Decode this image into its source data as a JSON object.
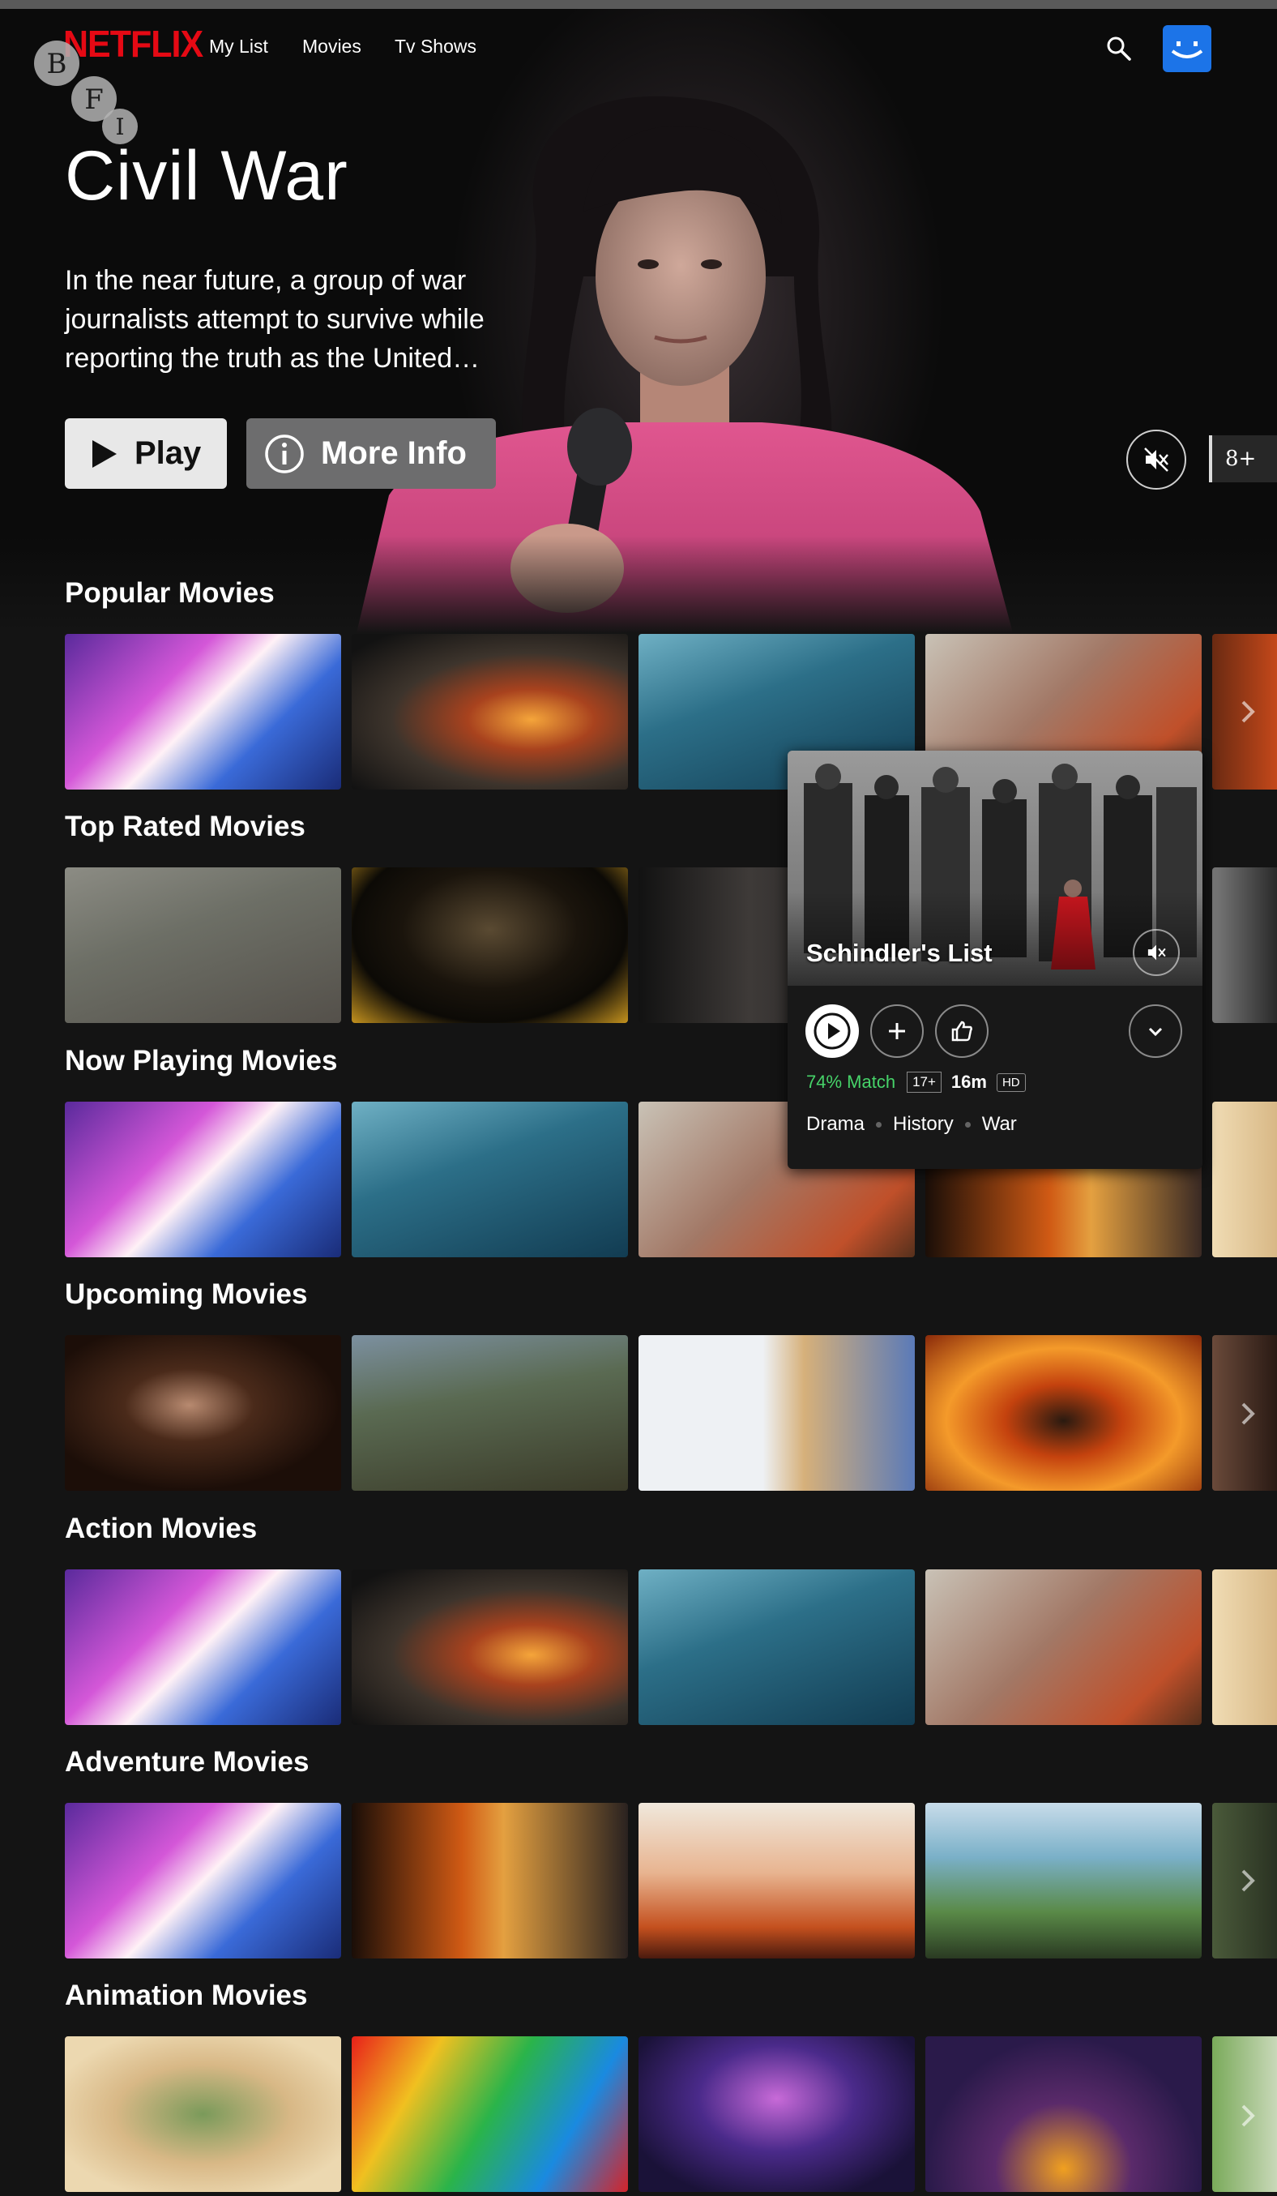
{
  "navbar": {
    "logo": "NETFLIX",
    "links": [
      "My List",
      "Movies",
      "Tv Shows"
    ],
    "icons": {
      "search": "search-icon",
      "profile": "profile-avatar"
    },
    "accent": "#e50914"
  },
  "watermark": {
    "letters": [
      "B",
      "F",
      "I"
    ]
  },
  "hero": {
    "title": "Civil War",
    "description": "In the near future, a group of war journalists attempt to survive while reporting the truth as the United…",
    "play_label": "Play",
    "info_label": "More Info",
    "maturity_rating": "8+"
  },
  "rows": [
    {
      "title": "Popular Movies"
    },
    {
      "title": "Top Rated Movies"
    },
    {
      "title": "Now Playing Movies"
    },
    {
      "title": "Upcoming Movies"
    },
    {
      "title": "Action Movies"
    },
    {
      "title": "Adventure Movies"
    },
    {
      "title": "Animation Movies"
    }
  ],
  "popup": {
    "title": "Schindler's List",
    "match": "74% Match",
    "age_rating": "17+",
    "duration": "16m",
    "quality": "HD",
    "genres": [
      "Drama",
      "History",
      "War"
    ],
    "match_color": "#46d369"
  }
}
